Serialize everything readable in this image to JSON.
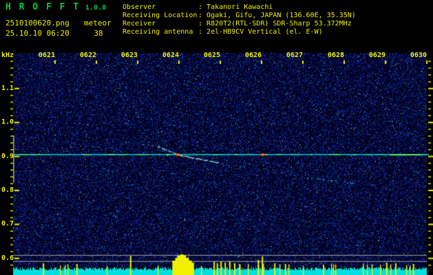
{
  "header": {
    "app_title": "H R O F F T",
    "version": "1.0.0",
    "filename": "2510100620.png",
    "mode": "meteor",
    "datetime": "25.10.10 06:20",
    "count": "38",
    "info_rows": [
      {
        "label": "Observer",
        "value": "Takanori Kawachi"
      },
      {
        "label": "Receiving Location",
        "value": "Ogaki, Gifu, JAPAN (136.60E, 35.35N)"
      },
      {
        "label": "Receiver",
        "value": "R820T2(RTL-SDR) SDR-Sharp 53.372MHz"
      },
      {
        "label": "Receiving antenna",
        "value": "2el-HB9CV Vertical (el. E-W)"
      }
    ]
  },
  "colors": {
    "background": "#000000",
    "title_green": "#00C840",
    "text_yellow": "#F0F000",
    "noise_field_base": "#000018",
    "carrier_cyan": "#00C4C4",
    "hotspot_red": "#E02800",
    "strip_cyan": "#00E0E0",
    "gray_line": "#A8A8A8"
  },
  "chart_data": {
    "type": "heatmap",
    "subtype": "radio-meteor-echo-spectrogram",
    "title": "HROFFT 10-minute spectrogram 25.10.10 06:20-06:30",
    "x_axis": {
      "unit_label": "",
      "start": "0620",
      "end": "0630",
      "minutes_span": 10,
      "ticks": [
        "0621",
        "0622",
        "0623",
        "0624",
        "0625",
        "0626",
        "0627",
        "0628",
        "0629",
        "0630"
      ]
    },
    "y_axis": {
      "unit_label": "kHz",
      "minor_tick_khz": 0.02,
      "range_khz": [
        0.578,
        1.19
      ],
      "ticks": [
        {
          "label": "1.1",
          "khz": 1.1
        },
        {
          "label": "1.0",
          "khz": 1.0
        },
        {
          "label": "0.9",
          "khz": 0.9
        },
        {
          "label": "0.8",
          "khz": 0.8
        },
        {
          "label": "0.7",
          "khz": 0.7
        },
        {
          "label": "0.6",
          "khz": 0.6
        }
      ]
    },
    "carrier_line": {
      "khz": 0.906,
      "colors": [
        "#00C4C4",
        "#20E0A0",
        "#48E868",
        "#00A8E0",
        "#90F090"
      ],
      "bright_green_run_minutes": [
        9.1,
        9.85
      ]
    },
    "hot_spots": [
      {
        "m": 3.97,
        "khz": 0.906
      },
      {
        "m": 6.02,
        "khz": 0.906
      }
    ],
    "meteor_trail": {
      "description": "meteor head echo drifting down in frequency while crossing the carrier",
      "segments": [
        {
          "from": {
            "m": 3.08,
            "khz": 0.936
          },
          "to": {
            "m": 3.45,
            "khz": 0.931
          },
          "intensity": "faint"
        },
        {
          "from": {
            "m": 3.45,
            "khz": 0.931
          },
          "to": {
            "m": 3.97,
            "khz": 0.906
          },
          "intensity": "bright"
        },
        {
          "from": {
            "m": 3.97,
            "khz": 0.906
          },
          "to": {
            "m": 4.93,
            "khz": 0.883
          },
          "intensity": "bright"
        },
        {
          "from": {
            "m": 5.0,
            "khz": 0.881
          },
          "to": {
            "m": 5.7,
            "khz": 0.867
          },
          "intensity": "faint"
        },
        {
          "from": {
            "m": 6.08,
            "khz": 0.859
          },
          "to": {
            "m": 6.8,
            "khz": 0.849
          },
          "intensity": "faint"
        },
        {
          "from": {
            "m": 7.2,
            "khz": 0.838
          },
          "to": {
            "m": 8.2,
            "khz": 0.822
          },
          "intensity": "medium"
        }
      ],
      "extra_dots": [
        {
          "m": 9.47,
          "khz": 0.838
        },
        {
          "m": 9.6,
          "khz": 0.834
        }
      ]
    },
    "reference_lines_khz": [
      0.61,
      0.592
    ],
    "freq_marker_bar": {
      "khz_from": 0.962,
      "khz_to": 0.824
    },
    "signal_strip": {
      "top_khz": 0.573,
      "color": "#00E0E0",
      "spike_color": "#F0F000",
      "spikes": [
        [
          0.72,
          6,
          2
        ],
        [
          1.53,
          5,
          2
        ],
        [
          2.83,
          17,
          2
        ],
        [
          3.88,
          10,
          5
        ],
        [
          3.95,
          14,
          5
        ],
        [
          4.0,
          17,
          5
        ],
        [
          4.07,
          19,
          5
        ],
        [
          4.13,
          18,
          5
        ],
        [
          4.2,
          14,
          5
        ],
        [
          4.27,
          10,
          5
        ],
        [
          4.33,
          7,
          4
        ],
        [
          4.85,
          8,
          2
        ],
        [
          4.93,
          6,
          2
        ],
        [
          5.02,
          9,
          2
        ],
        [
          5.12,
          7,
          2
        ],
        [
          5.23,
          9,
          2
        ],
        [
          5.35,
          6,
          2
        ],
        [
          5.47,
          5,
          2
        ],
        [
          5.92,
          11,
          2
        ],
        [
          6.02,
          16,
          2
        ],
        [
          6.32,
          6,
          2
        ],
        [
          6.58,
          5,
          2
        ],
        [
          7.5,
          4,
          2
        ],
        [
          9.03,
          7,
          2
        ],
        [
          9.25,
          6,
          2
        ],
        [
          9.68,
          5,
          2
        ]
      ]
    }
  }
}
